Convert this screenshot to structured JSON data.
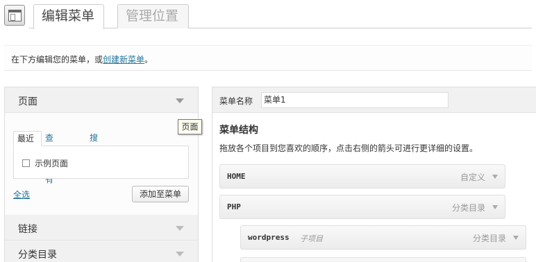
{
  "tabs": [
    {
      "label": "编辑菜单",
      "active": true
    },
    {
      "label": "管理位置",
      "active": false
    }
  ],
  "info": {
    "prefix": "在下方编辑您的菜单，或",
    "link": "创建新菜单",
    "suffix": "。"
  },
  "left": {
    "sections": [
      {
        "title": "页面",
        "expanded": true
      },
      {
        "title": "链接",
        "expanded": false
      },
      {
        "title": "分类目录",
        "expanded": false
      }
    ],
    "tooltip": "页面",
    "sub_tabs": [
      "最近",
      "查看所有",
      "搜索"
    ],
    "checkbox_label": "示例页面",
    "select_all": "全选",
    "add_button": "添加至菜单"
  },
  "right": {
    "name_label": "菜单名称",
    "name_value": "菜单1",
    "structure_title": "菜单结构",
    "structure_desc": "拖放各个项目到您喜欢的顺序，点击右侧的箭头可进行更详细的设置。",
    "items": [
      {
        "label": "HOME",
        "type": "自定义",
        "sub": ""
      },
      {
        "label": "PHP",
        "type": "分类目录",
        "sub": ""
      },
      {
        "label": "wordpress",
        "type": "分类目录",
        "sub": "子项目"
      }
    ]
  },
  "icons": {
    "screen_icon": "menus-window-icon",
    "accordion_arrow": "chevron-down-icon"
  }
}
